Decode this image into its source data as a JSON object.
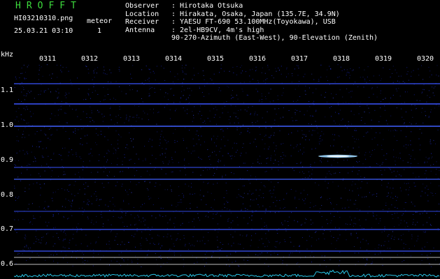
{
  "header": {
    "app_title": "HROFFT",
    "filename": "HI03210310.png",
    "datetime": "25.03.21 03:10",
    "meteor_label": "meteor",
    "meteor_count": "1"
  },
  "metadata": [
    {
      "key": "Observer",
      "sep": ":",
      "value": "Hirotaka Otsuka"
    },
    {
      "key": "Location",
      "sep": ":",
      "value": "Hirakata, Osaka, Japan (135.7E, 34.9N)"
    },
    {
      "key": "Receiver",
      "sep": ":",
      "value": "YAESU FT-690 53.100MHz(Toyokawa), USB"
    },
    {
      "key": "Antenna",
      "sep": ":",
      "value": "2el-HB9CV, 4m's high"
    }
  ],
  "antenna_continuation": "90-270-Azimuth (East-West), 90-Elevation (Zenith)",
  "axis": {
    "unit": "kHz",
    "time_ticks": [
      "0311",
      "0312",
      "0313",
      "0314",
      "0315",
      "0316",
      "0317",
      "0318",
      "0319",
      "0320"
    ],
    "freq_ticks": [
      "1.1",
      "1.0",
      "0.9",
      "0.8",
      "0.7",
      "0.6"
    ]
  },
  "colors": {
    "background": "#000000",
    "title_green": "#3ddc3d",
    "noise_blue": "#1a28c8",
    "carrier_blue": "#3a55ff",
    "meteor_echo": "#9fd8ff",
    "bottom_trace": "#29c5e6",
    "grid_line": "#bfbfbf"
  }
}
